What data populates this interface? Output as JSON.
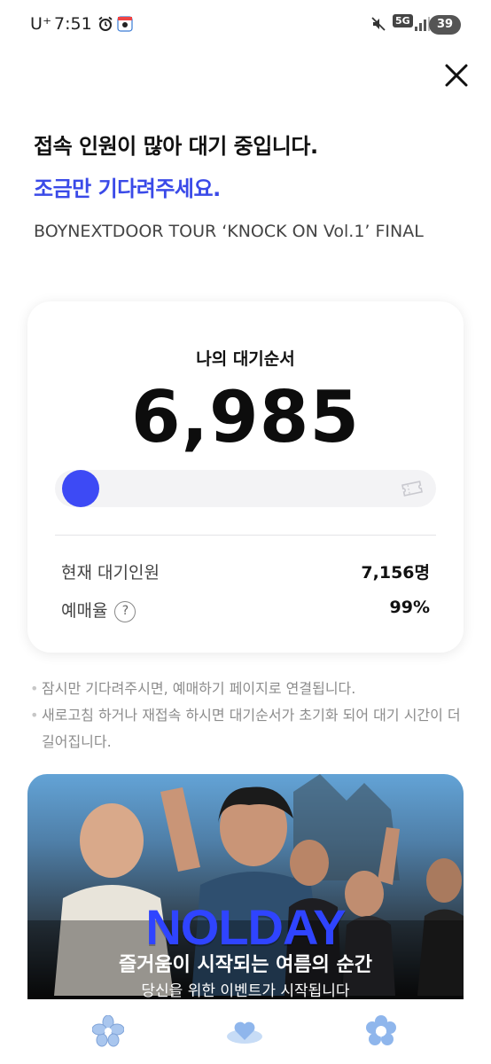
{
  "status_bar": {
    "carrier": "U⁺",
    "time": "7:51",
    "network": "5G",
    "battery": "39",
    "icons": [
      "alarm-icon",
      "location-icon",
      "mute-icon",
      "signal-icon"
    ]
  },
  "header": {
    "close_icon": "close-icon"
  },
  "message": {
    "title": "접속 인원이 많아 대기 중입니다.",
    "subtitle": "조금만 기다려주세요.",
    "event_name": "BOYNEXTDOOR TOUR ‘KNOCK ON Vol.1’ FINAL"
  },
  "queue": {
    "label": "나의 대기순서",
    "number": "6,985",
    "progress_fraction": 0.02,
    "current_waiting_label": "현재 대기인원",
    "current_waiting_value": "7,156명",
    "booking_rate_label": "예매율",
    "help_symbol": "?",
    "booking_rate_value": "99%"
  },
  "notes": [
    "잠시만 기다려주시면, 예매하기 페이지로 연결됩니다.",
    "새로고침 하거나 재접속 하시면 대기순서가 초기화 되어 대기 시간이 더 길어집니다."
  ],
  "banner": {
    "brand": "NOLDAY",
    "headline": "즐거움이 시작되는 여름의 순간",
    "sub": "당신을 위한 이벤트가 시작됩니다"
  },
  "bottom_nav": [
    "flower-icon",
    "heart-cloud-icon",
    "daisy-icon"
  ],
  "colors": {
    "accent": "#3a4ae8",
    "progress": "#3d4af5",
    "banner_brand": "#2f44ff"
  }
}
